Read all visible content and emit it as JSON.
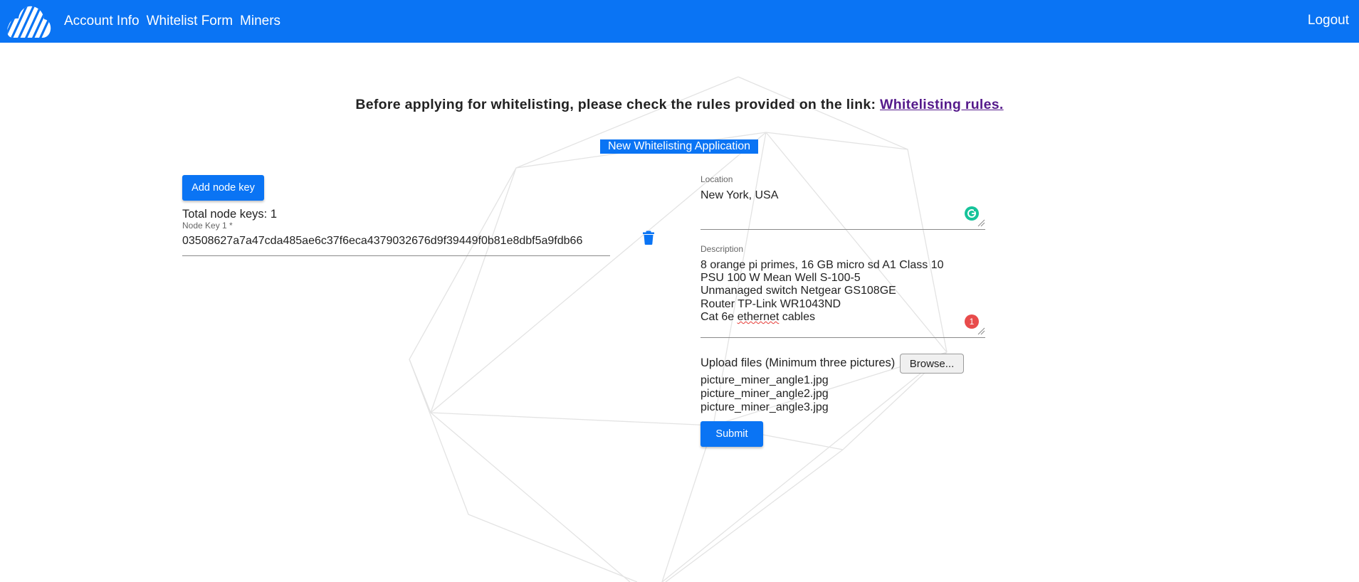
{
  "nav": {
    "links": [
      "Account Info",
      "Whitelist Form",
      "Miners"
    ],
    "logout": "Logout"
  },
  "notice": {
    "text": "Before applying for whitelisting, please check the rules provided on the link: ",
    "link_text": "Whitelisting rules."
  },
  "form": {
    "title": "New Whitelisting Application",
    "add_node_key_label": "Add node key",
    "total_node_keys": "Total node keys: 1",
    "node_key": {
      "label": "Node Key 1 *",
      "value": "03508627a7a47cda485ae6c37f6eca4379032676d9f39449f0b81e8dbf5a9fdb66"
    },
    "location": {
      "label": "Location",
      "value": "New York, USA"
    },
    "description": {
      "label": "Description",
      "lines": [
        "8 orange pi primes, 16 GB micro sd A1 Class 10",
        "PSU 100 W Mean Well S-100-5",
        "Unmanaged switch Netgear GS108GE",
        "Router TP-Link WR1043ND"
      ],
      "last_line": {
        "before": "Cat 6e ",
        "misspelled": "ethernet",
        "after": " cables"
      },
      "error_count": "1"
    },
    "upload": {
      "label": "Upload files (Minimum three pictures)",
      "browse_label": "Browse...",
      "files": [
        "picture_miner_angle1.jpg",
        "picture_miner_angle2.jpg",
        "picture_miner_angle3.jpg"
      ]
    },
    "submit_label": "Submit"
  },
  "colors": {
    "primary": "#0a74f4",
    "link_visited": "#551a8b",
    "grammarly": "#15c39a",
    "error": "#e84b4b"
  },
  "icons": {
    "logo": "cloud-logo-icon",
    "delete": "trash-icon",
    "grammarly": "grammarly-icon"
  }
}
